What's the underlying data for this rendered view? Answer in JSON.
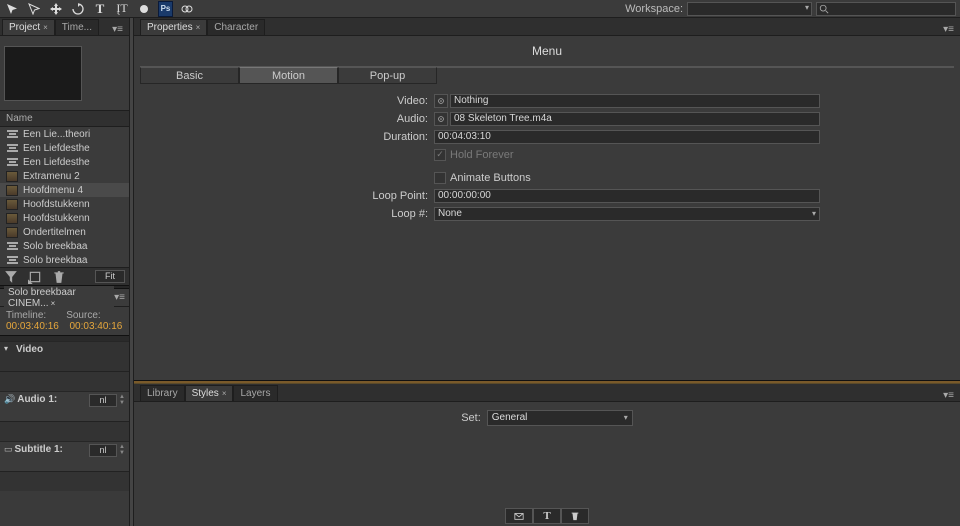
{
  "toolbar": {
    "workspace_label": "Workspace:",
    "workspace_value": "",
    "search_placeholder": ""
  },
  "panels": {
    "project_tab": "Project",
    "time_tab": "Time...",
    "properties_tab": "Properties",
    "character_tab": "Character",
    "library_tab": "Library",
    "styles_tab": "Styles",
    "layers_tab": "Layers"
  },
  "project": {
    "name_header": "Name",
    "fit_label": "Fit",
    "items": [
      {
        "type": "tl",
        "label": "Een Lie...theori"
      },
      {
        "type": "tl",
        "label": "Een Liefdesthe"
      },
      {
        "type": "tl",
        "label": "Een Liefdesthe"
      },
      {
        "type": "menu",
        "label": "Extramenu 2"
      },
      {
        "type": "menu",
        "label": "Hoofdmenu 4"
      },
      {
        "type": "menu",
        "label": "Hoofdstukkenn"
      },
      {
        "type": "menu",
        "label": "Hoofdstukkenn"
      },
      {
        "type": "menu",
        "label": "Ondertitelmen"
      },
      {
        "type": "tl",
        "label": "Solo breekbaa"
      },
      {
        "type": "tl",
        "label": "Solo breekbaa"
      }
    ]
  },
  "timeline": {
    "title": "Solo breekbaar CINEM...",
    "timeline_label": "Timeline:",
    "source_label": "Source:",
    "timeline_value": "00:03:40:16",
    "source_value": "00:03:40:16",
    "video_label": "Video",
    "audio_label": "Audio 1:",
    "subtitle_label": "Subtitle 1:",
    "lang_audio": "nl",
    "lang_sub": "nl"
  },
  "properties": {
    "title": "Menu",
    "tabs": {
      "basic": "Basic",
      "motion": "Motion",
      "popup": "Pop-up"
    },
    "active_tab": "motion",
    "fields": {
      "video_label": "Video:",
      "video_value": "Nothing",
      "audio_label": "Audio:",
      "audio_value": "08 Skeleton Tree.m4a",
      "duration_label": "Duration:",
      "duration_value": "00:04:03:10",
      "hold_forever": "Hold Forever",
      "animate_buttons": "Animate Buttons",
      "loop_point_label": "Loop Point:",
      "loop_point_value": "00:00:00:00",
      "loop_num_label": "Loop #:",
      "loop_num_value": "None"
    }
  },
  "styles": {
    "set_label": "Set:",
    "set_value": "General"
  }
}
